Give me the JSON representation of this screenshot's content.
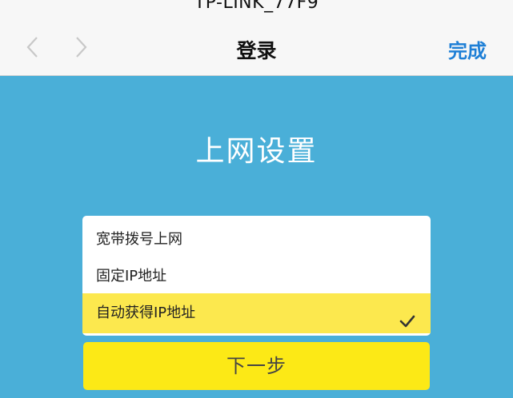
{
  "status_bar": {
    "ssid": "TP-LINK_77F9"
  },
  "nav": {
    "back_icon": "chevron-left-icon",
    "forward_icon": "chevron-right-icon",
    "title": "登录",
    "done_label": "完成"
  },
  "page": {
    "heading": "上网设置"
  },
  "options": [
    {
      "label": "宽带拨号上网",
      "selected": false
    },
    {
      "label": "固定IP地址",
      "selected": false
    },
    {
      "label": "自动获得IP地址",
      "selected": true
    }
  ],
  "check_icon": "checkmark-icon",
  "next_label": "下一步",
  "colors": {
    "background": "#4AAFD8",
    "topbar": "#F7F7F7",
    "accent_link": "#1E7FD6",
    "selected_row": "#FCE84E",
    "next_button": "#FCE916"
  }
}
